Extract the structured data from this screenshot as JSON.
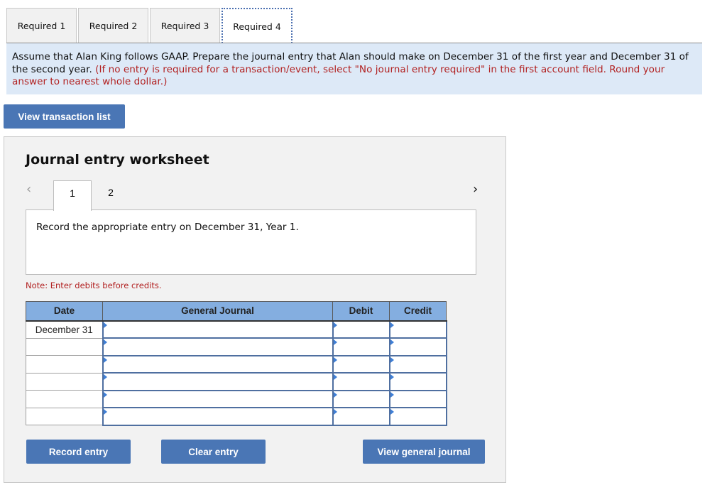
{
  "tabs": [
    {
      "label": "Required 1",
      "active": false
    },
    {
      "label": "Required 2",
      "active": false
    },
    {
      "label": "Required 3",
      "active": false
    },
    {
      "label": "Required 4",
      "active": true
    }
  ],
  "instructions": {
    "main": "Assume that Alan King follows GAAP. Prepare the journal entry that Alan should make on December 31 of the first year and December 31 of the second year.",
    "note": "(If no entry is required for a transaction/event, select \"No journal entry required\" in the first account field. Round your answer to nearest whole dollar.)"
  },
  "view_transaction_list_label": "View transaction list",
  "worksheet": {
    "title": "Journal entry worksheet",
    "prev_icon": "‹",
    "next_icon": "›",
    "pages": [
      "1",
      "2"
    ],
    "active_page": "1",
    "description": "Record the appropriate entry on December 31, Year 1.",
    "note": "Note: Enter debits before credits.",
    "table": {
      "headers": [
        "Date",
        "General Journal",
        "Debit",
        "Credit"
      ],
      "rows": [
        {
          "date": "December 31",
          "account": "",
          "debit": "",
          "credit": ""
        },
        {
          "date": "",
          "account": "",
          "debit": "",
          "credit": ""
        },
        {
          "date": "",
          "account": "",
          "debit": "",
          "credit": ""
        },
        {
          "date": "",
          "account": "",
          "debit": "",
          "credit": ""
        },
        {
          "date": "",
          "account": "",
          "debit": "",
          "credit": ""
        },
        {
          "date": "",
          "account": "",
          "debit": "",
          "credit": ""
        }
      ]
    },
    "buttons": {
      "record": "Record entry",
      "clear": "Clear entry",
      "view_general_journal": "View general journal"
    }
  },
  "colors": {
    "button_blue": "#4a76b5",
    "header_blue": "#84aee0",
    "instruction_bg": "#dde9f7",
    "note_red": "#b22222"
  }
}
